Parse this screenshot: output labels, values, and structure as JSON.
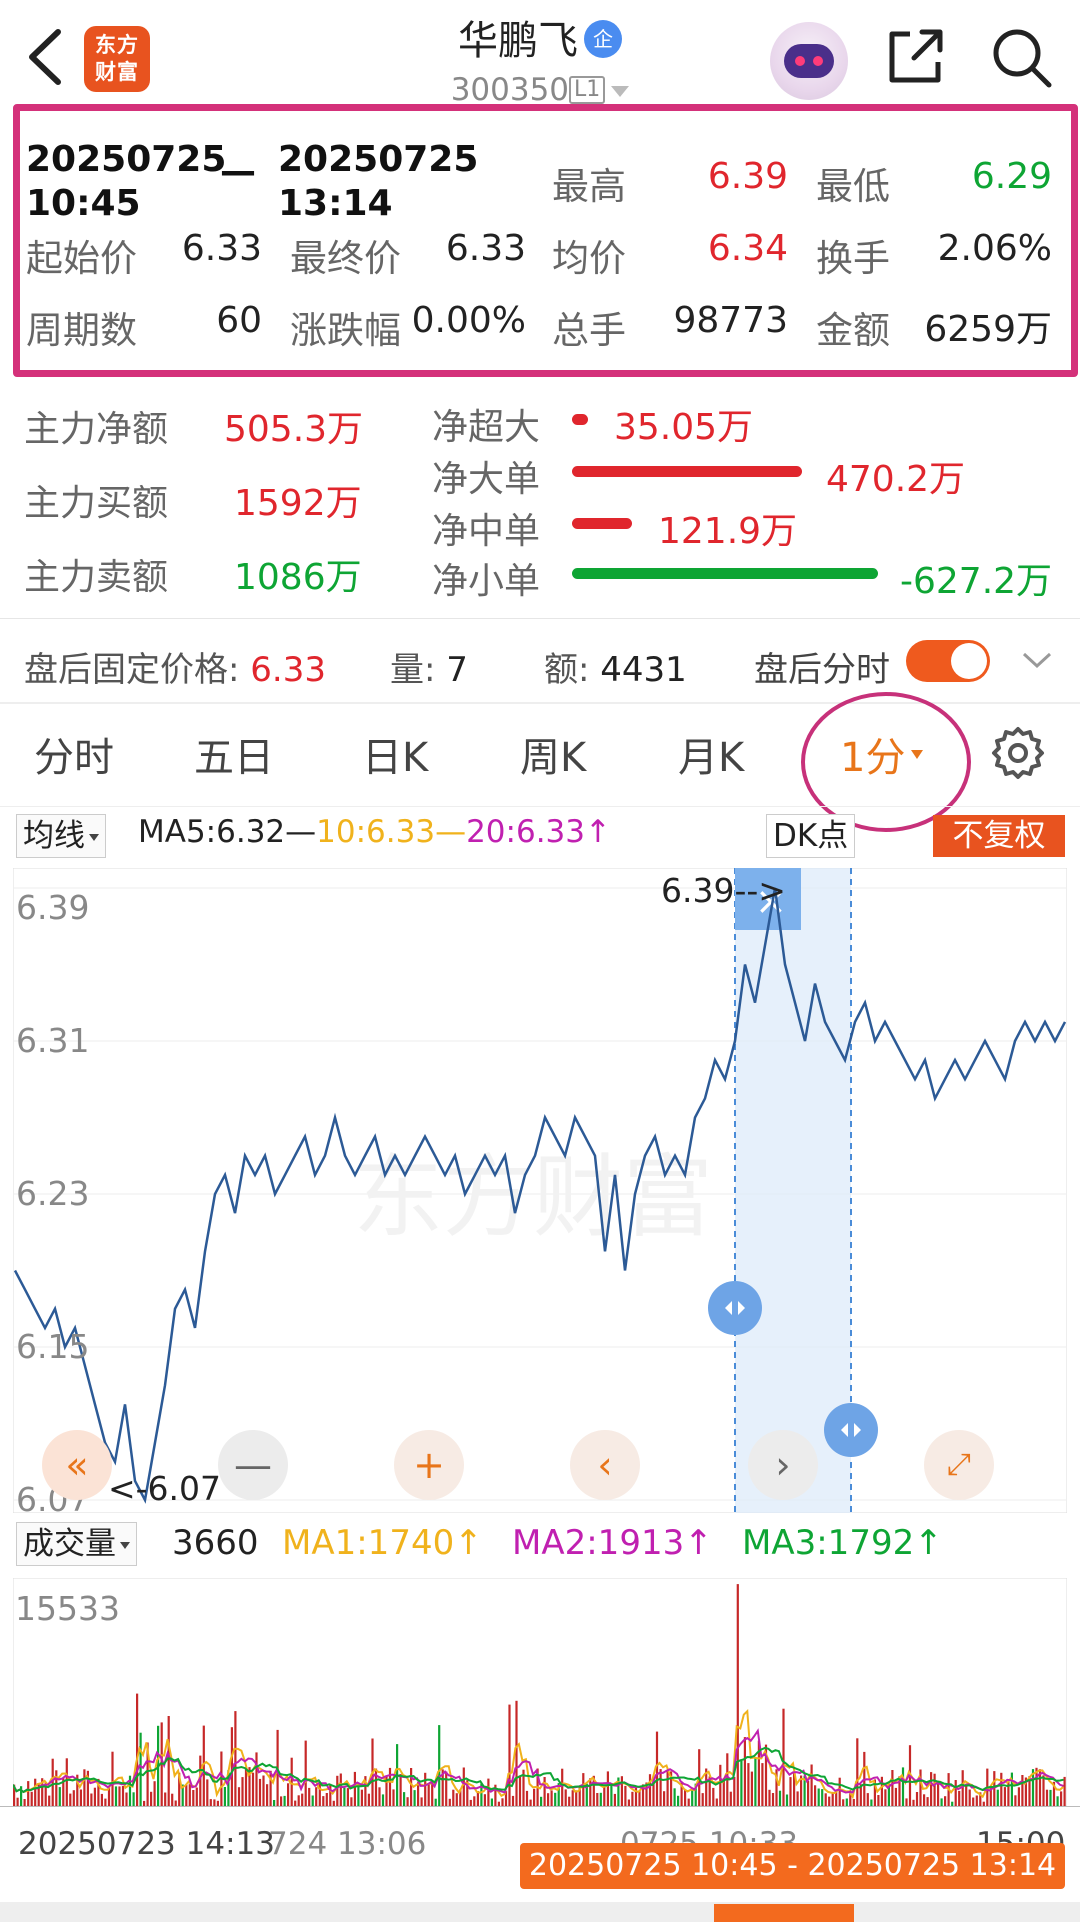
{
  "header": {
    "logo_line1": "东方",
    "logo_line2": "财富",
    "stock_name": "华鹏飞",
    "verified_badge": "企",
    "stock_code": "300350",
    "level_tag": "L1"
  },
  "range_stats": {
    "start_date": "20250725",
    "start_time": "10:45",
    "separator": "—",
    "end_date": "20250725",
    "end_time": "13:14",
    "rows": [
      [
        {
          "label": "最高",
          "value": "6.39"
        },
        {
          "label": "最低",
          "value": "6.29"
        }
      ],
      [
        {
          "label": "起始价",
          "value": "6.33"
        },
        {
          "label": "最终价",
          "value": "6.33"
        },
        {
          "label": "均价",
          "value": "6.34"
        },
        {
          "label": "换手",
          "value": "2.06%"
        }
      ],
      [
        {
          "label": "周期数",
          "value": "60"
        },
        {
          "label": "涨跌幅",
          "value": "0.00%"
        },
        {
          "label": "总手",
          "value": "98773"
        },
        {
          "label": "金额",
          "value": "6259万"
        }
      ]
    ]
  },
  "capital_flow": {
    "main_net_label": "主力净额",
    "main_net": "505.3万",
    "main_buy_label": "主力买额",
    "main_buy": "1592万",
    "main_sell_label": "主力卖额",
    "main_sell": "1086万",
    "super_large_label": "净超大",
    "super_large": "35.05万",
    "large_label": "净大单",
    "large": "470.2万",
    "medium_label": "净中单",
    "medium": "121.9万",
    "small_label": "净小单",
    "small": "-627.2万",
    "colors": {
      "positive": "#e0262d",
      "negative": "#0ea534"
    }
  },
  "after_hours": {
    "fixed_price_label": "盘后固定价格:",
    "fixed_price": "6.33",
    "volume_label": "量:",
    "volume": "7",
    "amount_label": "额:",
    "amount": "4431",
    "toggle_label": "盘后分时",
    "toggle_on": true
  },
  "tabs": [
    {
      "label": "分时"
    },
    {
      "label": "五日"
    },
    {
      "label": "日K"
    },
    {
      "label": "周K"
    },
    {
      "label": "月K"
    },
    {
      "label": "1分",
      "active": true
    }
  ],
  "ma_row": {
    "selector": "均线",
    "ma5": "MA5:6.32—",
    "ma10": "10:6.33—",
    "ma20": "20:6.33↑",
    "dk_button": "DK点",
    "adjust_badge": "不复权",
    "colors": {
      "ma5": "#222222",
      "ma10": "#f0b21c",
      "ma20": "#c020b0"
    }
  },
  "chart_data": [
    {
      "type": "line",
      "series": [
        {
          "values": [
            6.19,
            6.18,
            6.17,
            6.16,
            6.17,
            6.15,
            6.16,
            6.14,
            6.12,
            6.1,
            6.09,
            6.12,
            6.08,
            6.07,
            6.1,
            6.13,
            6.17,
            6.18,
            6.16,
            6.2,
            6.23,
            6.24,
            6.22,
            6.25,
            6.24,
            6.25,
            6.23,
            6.24,
            6.25,
            6.26,
            6.24,
            6.25,
            6.27,
            6.25,
            6.24,
            6.25,
            6.26,
            6.24,
            6.25,
            6.24,
            6.25,
            6.26,
            6.25,
            6.24,
            6.25,
            6.23,
            6.24,
            6.25,
            6.24,
            6.25,
            6.22,
            6.24,
            6.25,
            6.27,
            6.26,
            6.25,
            6.27,
            6.26,
            6.25,
            6.2,
            6.24,
            6.19,
            6.23,
            6.25,
            6.26,
            6.24,
            6.25,
            6.24,
            6.27,
            6.28,
            6.3,
            6.29,
            6.31,
            6.35,
            6.33,
            6.36,
            6.39,
            6.35,
            6.33,
            6.31,
            6.34,
            6.32,
            6.31,
            6.3,
            6.32,
            6.33,
            6.31,
            6.32,
            6.31,
            6.3,
            6.29,
            6.3,
            6.28,
            6.29,
            6.3,
            6.29,
            6.3,
            6.31,
            6.3,
            6.29,
            6.31,
            6.32,
            6.31,
            6.32,
            6.31,
            6.32
          ]
        }
      ],
      "y_ticks": [
        "6.39",
        "6.31",
        "6.23",
        "6.15",
        "6.07"
      ],
      "ylim": [
        6.07,
        6.39
      ],
      "annotations": {
        "high": "6.39-->",
        "low": "<-6.07"
      }
    },
    {
      "type": "bar",
      "selector": "成交量",
      "current": "3660",
      "ma1": "MA1:1740↑",
      "ma2": "MA2:1913↑",
      "ma3": "MA3:1792↑",
      "y_max_label": "15533",
      "ylim": [
        0,
        15533
      ]
    }
  ],
  "time_axis": {
    "left": "20250723 14:13",
    "mid": "724 13:06",
    "right_partial": "0725 10:33",
    "end": "15:00"
  },
  "range_badge": "20250725 10:45 - 20250725 13:14",
  "watermark": "东方财富"
}
